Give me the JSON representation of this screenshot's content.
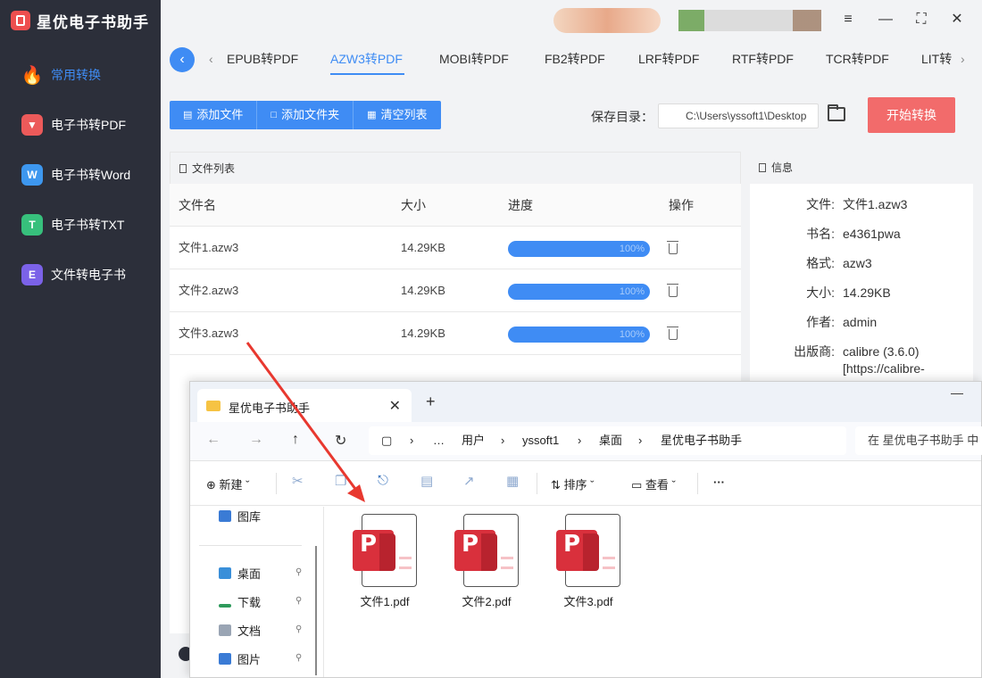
{
  "app": {
    "title": "星优电子书助手"
  },
  "sidebar": {
    "items": [
      {
        "label": "常用转换",
        "icon": "fire-icon",
        "active": true
      },
      {
        "label": "电子书转PDF",
        "icon": "pdf-icon"
      },
      {
        "label": "电子书转Word",
        "icon": "word-icon"
      },
      {
        "label": "电子书转TXT",
        "icon": "txt-icon"
      },
      {
        "label": "文件转电子书",
        "icon": "ebook-icon"
      }
    ]
  },
  "tabs": {
    "items": [
      "EPUB转PDF",
      "AZW3转PDF",
      "MOBI转PDF",
      "FB2转PDF",
      "LRF转PDF",
      "RTF转PDF",
      "TCR转PDF",
      "LIT转"
    ],
    "active_index": 1
  },
  "toolbar": {
    "add_file": "添加文件",
    "add_folder": "添加文件夹",
    "clear_list": "清空列表",
    "save_label": "保存目录：",
    "save_path": "C:\\Users\\yssoft1\\Desktop",
    "start": "开始转换"
  },
  "filelist": {
    "title": "文件列表",
    "headers": {
      "name": "文件名",
      "size": "大小",
      "progress": "进度",
      "op": "操作"
    },
    "rows": [
      {
        "name": "文件1.azw3",
        "size": "14.29KB",
        "progress": "100%"
      },
      {
        "name": "文件2.azw3",
        "size": "14.29KB",
        "progress": "100%"
      },
      {
        "name": "文件3.azw3",
        "size": "14.29KB",
        "progress": "100%"
      }
    ]
  },
  "info": {
    "title": "信息",
    "rows": [
      {
        "k": "文件:",
        "v": "文件1.azw3"
      },
      {
        "k": "书名:",
        "v": "e4361pwa"
      },
      {
        "k": "格式:",
        "v": "azw3"
      },
      {
        "k": "大小:",
        "v": "14.29KB"
      },
      {
        "k": "作者:",
        "v": "admin"
      },
      {
        "k": "出版商:",
        "v": "calibre (3.6.0) [https://calibre-"
      }
    ]
  },
  "explorer": {
    "tab_title": "星优电子书助手",
    "breadcrumb": [
      "…",
      "用户",
      "yssoft1",
      "桌面",
      "星优电子书助手"
    ],
    "search_placeholder": "在 星优电子书助手 中",
    "commands": {
      "new": "新建",
      "sort": "排序",
      "view": "查看"
    },
    "side": [
      {
        "label": "图库",
        "icon": "gallery-icon"
      },
      {
        "label": "桌面",
        "icon": "desktop-icon"
      },
      {
        "label": "下载",
        "icon": "download-icon"
      },
      {
        "label": "文档",
        "icon": "document-icon"
      },
      {
        "label": "图片",
        "icon": "pictures-icon"
      }
    ],
    "files": [
      "文件1.pdf",
      "文件2.pdf",
      "文件3.pdf"
    ]
  },
  "colors": {
    "accent": "#3f8cf4",
    "start": "#f26b6b",
    "sidebar": "#2c2f3a"
  }
}
